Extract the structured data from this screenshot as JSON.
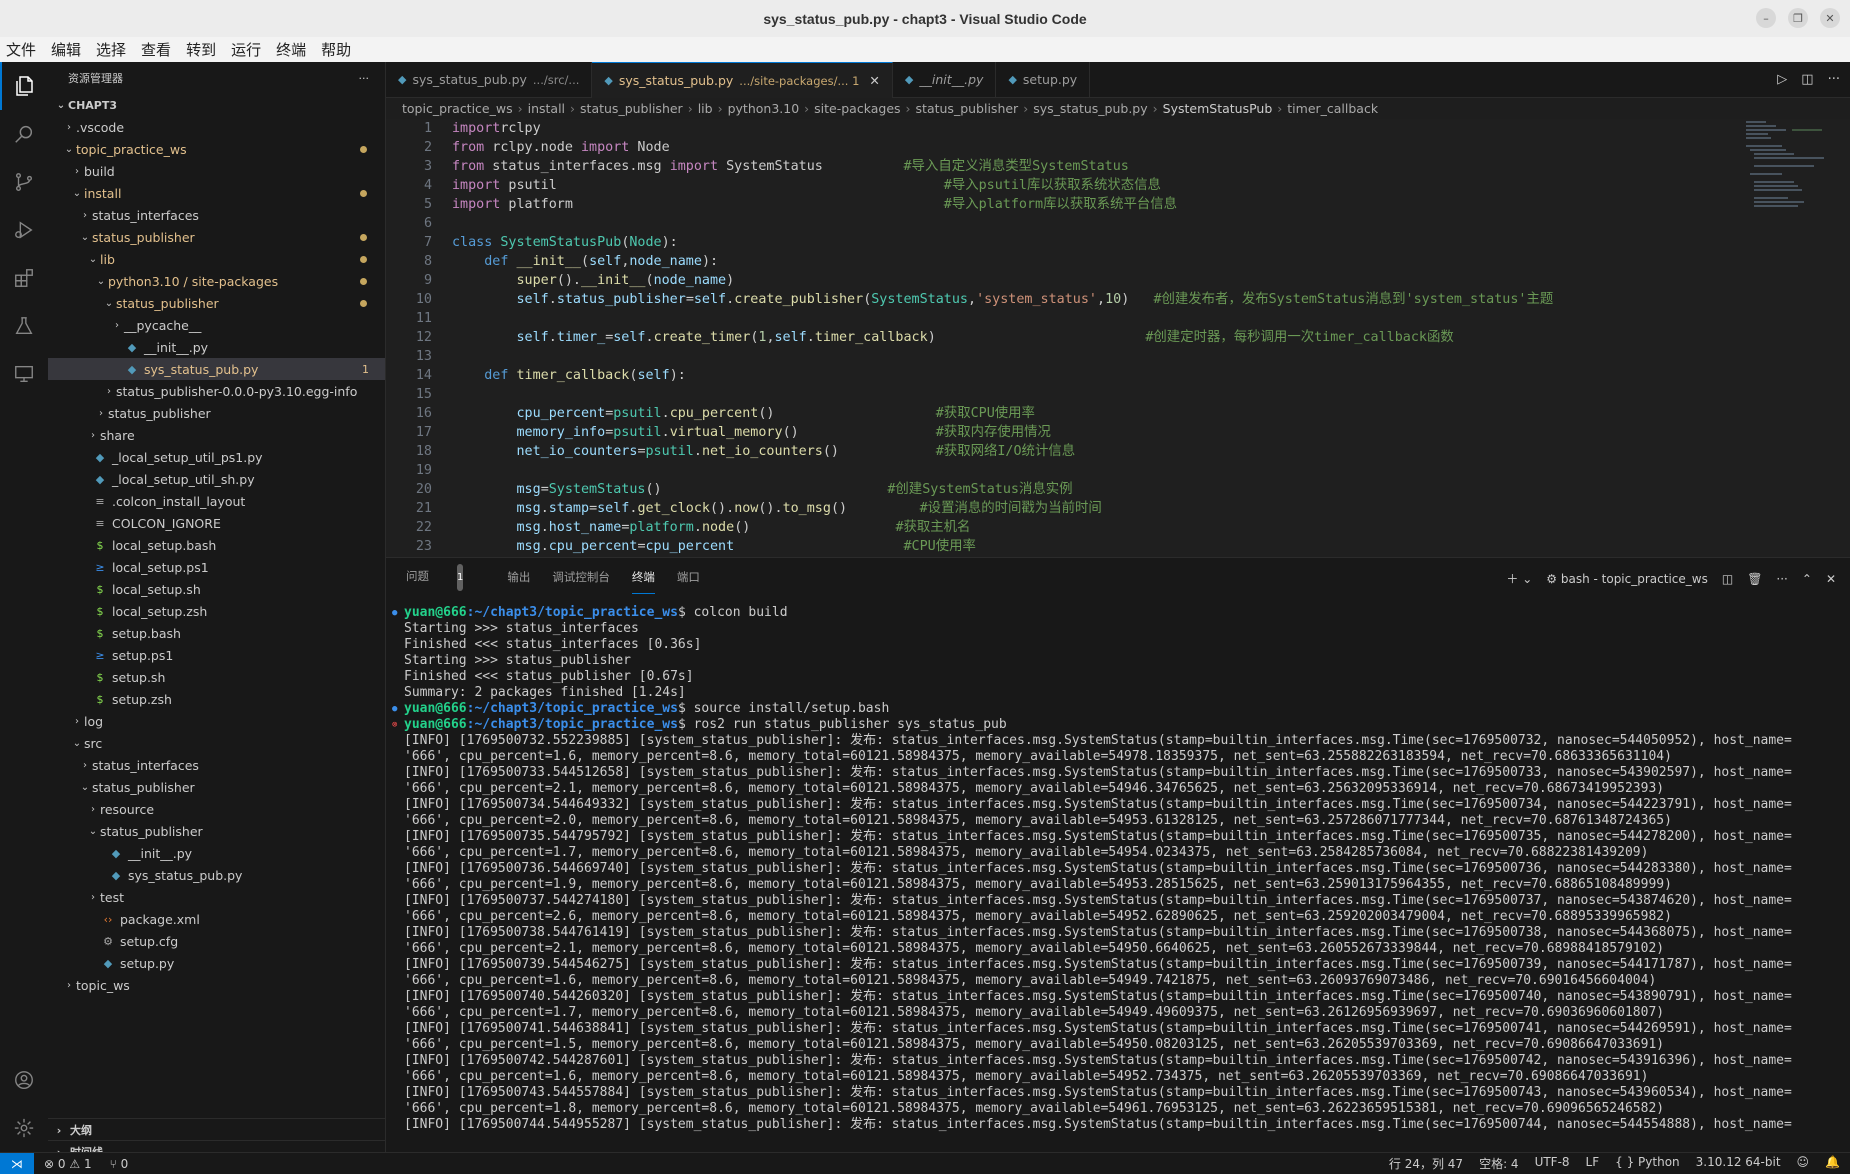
{
  "window": {
    "title": "sys_status_pub.py - chapt3 - Visual Studio Code"
  },
  "menu": [
    "文件",
    "编辑",
    "选择",
    "查看",
    "转到",
    "运行",
    "终端",
    "帮助"
  ],
  "sidebar": {
    "header": "资源管理器",
    "root": "CHAPT3",
    "tree": [
      {
        "label": ".vscode",
        "depth": 1,
        "chev": "›",
        "icon": ""
      },
      {
        "label": "topic_practice_ws",
        "depth": 1,
        "chev": "⌄",
        "icon": "",
        "mod": true,
        "dot": true
      },
      {
        "label": "build",
        "depth": 2,
        "chev": "›",
        "icon": ""
      },
      {
        "label": "install",
        "depth": 2,
        "chev": "⌄",
        "icon": "",
        "mod": true,
        "dot": true
      },
      {
        "label": "status_interfaces",
        "depth": 3,
        "chev": "›",
        "icon": ""
      },
      {
        "label": "status_publisher",
        "depth": 3,
        "chev": "⌄",
        "icon": "",
        "mod": true,
        "dot": true
      },
      {
        "label": "lib",
        "depth": 4,
        "chev": "⌄",
        "icon": "",
        "mod": true,
        "dot": true
      },
      {
        "label": "python3.10 / site-packages",
        "depth": 5,
        "chev": "⌄",
        "icon": "",
        "mod": true,
        "dot": true
      },
      {
        "label": "status_publisher",
        "depth": 6,
        "chev": "⌄",
        "icon": "",
        "mod": true,
        "dot": true
      },
      {
        "label": "__pycache__",
        "depth": 7,
        "chev": "›",
        "icon": ""
      },
      {
        "label": "__init__.py",
        "depth": 7,
        "chev": "",
        "icon": "py"
      },
      {
        "label": "sys_status_pub.py",
        "depth": 7,
        "chev": "",
        "icon": "py",
        "mod": true,
        "sel": true,
        "num": "1"
      },
      {
        "label": "status_publisher-0.0.0-py3.10.egg-info",
        "depth": 6,
        "chev": "›",
        "icon": ""
      },
      {
        "label": "status_publisher",
        "depth": 5,
        "chev": "›",
        "icon": ""
      },
      {
        "label": "share",
        "depth": 4,
        "chev": "›",
        "icon": ""
      },
      {
        "label": "_local_setup_util_ps1.py",
        "depth": 3,
        "chev": "",
        "icon": "py"
      },
      {
        "label": "_local_setup_util_sh.py",
        "depth": 3,
        "chev": "",
        "icon": "py"
      },
      {
        "label": ".colcon_install_layout",
        "depth": 3,
        "chev": "",
        "icon": "txt"
      },
      {
        "label": "COLCON_IGNORE",
        "depth": 3,
        "chev": "",
        "icon": "txt"
      },
      {
        "label": "local_setup.bash",
        "depth": 3,
        "chev": "",
        "icon": "sh"
      },
      {
        "label": "local_setup.ps1",
        "depth": 3,
        "chev": "",
        "icon": "ps"
      },
      {
        "label": "local_setup.sh",
        "depth": 3,
        "chev": "",
        "icon": "sh"
      },
      {
        "label": "local_setup.zsh",
        "depth": 3,
        "chev": "",
        "icon": "sh"
      },
      {
        "label": "setup.bash",
        "depth": 3,
        "chev": "",
        "icon": "sh"
      },
      {
        "label": "setup.ps1",
        "depth": 3,
        "chev": "",
        "icon": "ps"
      },
      {
        "label": "setup.sh",
        "depth": 3,
        "chev": "",
        "icon": "sh"
      },
      {
        "label": "setup.zsh",
        "depth": 3,
        "chev": "",
        "icon": "sh"
      },
      {
        "label": "log",
        "depth": 2,
        "chev": "›",
        "icon": ""
      },
      {
        "label": "src",
        "depth": 2,
        "chev": "⌄",
        "icon": ""
      },
      {
        "label": "status_interfaces",
        "depth": 3,
        "chev": "›",
        "icon": ""
      },
      {
        "label": "status_publisher",
        "depth": 3,
        "chev": "⌄",
        "icon": ""
      },
      {
        "label": "resource",
        "depth": 4,
        "chev": "›",
        "icon": ""
      },
      {
        "label": "status_publisher",
        "depth": 4,
        "chev": "⌄",
        "icon": ""
      },
      {
        "label": "__init__.py",
        "depth": 5,
        "chev": "",
        "icon": "py"
      },
      {
        "label": "sys_status_pub.py",
        "depth": 5,
        "chev": "",
        "icon": "py"
      },
      {
        "label": "test",
        "depth": 4,
        "chev": "›",
        "icon": ""
      },
      {
        "label": "package.xml",
        "depth": 4,
        "chev": "",
        "icon": "xml"
      },
      {
        "label": "setup.cfg",
        "depth": 4,
        "chev": "",
        "icon": "cfg"
      },
      {
        "label": "setup.py",
        "depth": 4,
        "chev": "",
        "icon": "py"
      },
      {
        "label": "topic_ws",
        "depth": 1,
        "chev": "›",
        "icon": ""
      }
    ],
    "outline": "大纲",
    "timeline": "时间线"
  },
  "tabs": [
    {
      "name": "sys_status_pub.py",
      "path": ".../src/...",
      "active": false
    },
    {
      "name": "sys_status_pub.py",
      "path": ".../site-packages/... 1",
      "active": true
    },
    {
      "name": "__init__.py",
      "path": "",
      "active": false
    },
    {
      "name": "setup.py",
      "path": "",
      "active": false
    }
  ],
  "breadcrumb": [
    "topic_practice_ws",
    "install",
    "status_publisher",
    "lib",
    "python3.10",
    "site-packages",
    "status_publisher",
    "sys_status_pub.py",
    "SystemStatusPub",
    "timer_callback"
  ],
  "code": [
    [
      [
        "kwc",
        "import"
      ],
      [
        "",
        "rclpy"
      ]
    ],
    [
      [
        "kwc",
        "from"
      ],
      [
        "",
        " rclpy.node "
      ],
      [
        "kwc",
        "import"
      ],
      [
        "",
        " Node"
      ]
    ],
    [
      [
        "kwc",
        "from"
      ],
      [
        "",
        " status_interfaces.msg "
      ],
      [
        "kwc",
        "import"
      ],
      [
        "",
        " SystemStatus          "
      ],
      [
        "cm",
        "#导入自定义消息类型SystemStatus"
      ]
    ],
    [
      [
        "kwc",
        "import"
      ],
      [
        "",
        " psutil                                                "
      ],
      [
        "cm",
        "#导入psutil库以获取系统状态信息"
      ]
    ],
    [
      [
        "kwc",
        "import"
      ],
      [
        "",
        " platform                                              "
      ],
      [
        "cm",
        "#导入platform库以获取系统平台信息"
      ]
    ],
    [],
    [
      [
        "kw",
        "class"
      ],
      [
        "",
        " "
      ],
      [
        "cls",
        "SystemStatusPub"
      ],
      [
        "",
        "("
      ],
      [
        "cls",
        "Node"
      ],
      [
        "",
        "):"
      ]
    ],
    [
      [
        "",
        "    "
      ],
      [
        "kw",
        "def"
      ],
      [
        "",
        " "
      ],
      [
        "fn",
        "__init__"
      ],
      [
        "",
        "("
      ],
      [
        "var",
        "self"
      ],
      [
        "",
        ","
      ],
      [
        "var",
        "node_name"
      ],
      [
        "",
        "):"
      ]
    ],
    [
      [
        "",
        "        "
      ],
      [
        "fn",
        "super"
      ],
      [
        "",
        "()."
      ],
      [
        "fn",
        "__init__"
      ],
      [
        "",
        "("
      ],
      [
        "var",
        "node_name"
      ],
      [
        "",
        ")"
      ]
    ],
    [
      [
        "",
        "        "
      ],
      [
        "var",
        "self"
      ],
      [
        "",
        "."
      ],
      [
        "var",
        "status_publisher"
      ],
      [
        "",
        "="
      ],
      [
        "var",
        "self"
      ],
      [
        "",
        "."
      ],
      [
        "fn",
        "create_publisher"
      ],
      [
        "",
        "("
      ],
      [
        "cls",
        "SystemStatus"
      ],
      [
        "",
        ","
      ],
      [
        "str",
        "'system_status'"
      ],
      [
        "",
        ","
      ],
      [
        "num-lit",
        "10"
      ],
      [
        "",
        ")   "
      ],
      [
        "cm",
        "#创建发布者，发布SystemStatus消息到'system_status'主题"
      ]
    ],
    [],
    [
      [
        "",
        "        "
      ],
      [
        "var",
        "self"
      ],
      [
        "",
        "."
      ],
      [
        "var",
        "timer_"
      ],
      [
        "",
        "="
      ],
      [
        "var",
        "self"
      ],
      [
        "",
        "."
      ],
      [
        "fn",
        "create_timer"
      ],
      [
        "",
        "("
      ],
      [
        "num-lit",
        "1"
      ],
      [
        "",
        ","
      ],
      [
        "var",
        "self"
      ],
      [
        "",
        "."
      ],
      [
        "fn",
        "timer_callback"
      ],
      [
        "",
        ")                          "
      ],
      [
        "cm",
        "#创建定时器，每秒调用一次timer_callback函数"
      ]
    ],
    [],
    [
      [
        "",
        "    "
      ],
      [
        "kw",
        "def"
      ],
      [
        "",
        " "
      ],
      [
        "fn",
        "timer_callback"
      ],
      [
        "",
        "("
      ],
      [
        "var",
        "self"
      ],
      [
        "",
        "):"
      ]
    ],
    [],
    [
      [
        "",
        "        "
      ],
      [
        "var",
        "cpu_percent"
      ],
      [
        "",
        "="
      ],
      [
        "cls",
        "psutil"
      ],
      [
        "",
        "."
      ],
      [
        "fn",
        "cpu_percent"
      ],
      [
        "",
        "()                    "
      ],
      [
        "cm",
        "#获取CPU使用率"
      ]
    ],
    [
      [
        "",
        "        "
      ],
      [
        "var",
        "memory_info"
      ],
      [
        "",
        "="
      ],
      [
        "cls",
        "psutil"
      ],
      [
        "",
        "."
      ],
      [
        "fn",
        "virtual_memory"
      ],
      [
        "",
        "()                 "
      ],
      [
        "cm",
        "#获取内存使用情况"
      ]
    ],
    [
      [
        "",
        "        "
      ],
      [
        "var",
        "net_io_counters"
      ],
      [
        "",
        "="
      ],
      [
        "cls",
        "psutil"
      ],
      [
        "",
        "."
      ],
      [
        "fn",
        "net_io_counters"
      ],
      [
        "",
        "()            "
      ],
      [
        "cm",
        "#获取网络I/O统计信息"
      ]
    ],
    [],
    [
      [
        "",
        "        "
      ],
      [
        "var",
        "msg"
      ],
      [
        "",
        "="
      ],
      [
        "cls",
        "SystemStatus"
      ],
      [
        "",
        "()                            "
      ],
      [
        "cm",
        "#创建SystemStatus消息实例"
      ]
    ],
    [
      [
        "",
        "        "
      ],
      [
        "var",
        "msg"
      ],
      [
        "",
        "."
      ],
      [
        "var",
        "stamp"
      ],
      [
        "",
        "="
      ],
      [
        "var",
        "self"
      ],
      [
        "",
        "."
      ],
      [
        "fn",
        "get_clock"
      ],
      [
        "",
        "()."
      ],
      [
        "fn",
        "now"
      ],
      [
        "",
        "()."
      ],
      [
        "fn",
        "to_msg"
      ],
      [
        "",
        "()         "
      ],
      [
        "cm",
        "#设置消息的时间戳为当前时间"
      ]
    ],
    [
      [
        "",
        "        "
      ],
      [
        "var",
        "msg"
      ],
      [
        "",
        "."
      ],
      [
        "var",
        "host_name"
      ],
      [
        "",
        "="
      ],
      [
        "cls",
        "platform"
      ],
      [
        "",
        "."
      ],
      [
        "fn",
        "node"
      ],
      [
        "",
        "()                  "
      ],
      [
        "cm",
        "#获取主机名"
      ]
    ],
    [
      [
        "",
        "        "
      ],
      [
        "var",
        "msg"
      ],
      [
        "",
        "."
      ],
      [
        "var",
        "cpu_percent"
      ],
      [
        "",
        "="
      ],
      [
        "var",
        "cpu_percent"
      ],
      [
        "",
        "                     "
      ],
      [
        "cm",
        "#CPU使用率"
      ]
    ]
  ],
  "panel": {
    "tabs": [
      "问题",
      "输出",
      "调试控制台",
      "终端",
      "端口"
    ],
    "problems_count": "1",
    "shell": "bash - topic_practice_ws"
  },
  "terminal": {
    "user": "yuan@666",
    "path": ":~/chapt3/topic_practice_ws",
    "lines": [
      {
        "t": "prompt",
        "m": "ok",
        "cmd": "$ colcon build"
      },
      {
        "t": "out",
        "text": "Starting >>> status_interfaces"
      },
      {
        "t": "out",
        "text": "Finished <<< status_interfaces [0.36s]"
      },
      {
        "t": "out",
        "text": "Starting >>> status_publisher"
      },
      {
        "t": "out",
        "text": "Finished <<< status_publisher [0.67s]"
      },
      {
        "t": "out",
        "text": ""
      },
      {
        "t": "out",
        "text": "Summary: 2 packages finished [1.24s]"
      },
      {
        "t": "prompt",
        "m": "ok",
        "cmd": "$ source install/setup.bash"
      },
      {
        "t": "prompt",
        "m": "err",
        "cmd": "$ ros2 run status_publisher sys_status_pub"
      },
      {
        "t": "out",
        "text": "[INFO] [1769500732.552239885] [system_status_publisher]: 发布: status_interfaces.msg.SystemStatus(stamp=builtin_interfaces.msg.Time(sec=1769500732, nanosec=544050952), host_name="
      },
      {
        "t": "out",
        "text": "'666', cpu_percent=1.6, memory_percent=8.6, memory_total=60121.58984375, memory_available=54978.18359375, net_sent=63.255882263183594, net_recv=70.68633365631104)"
      },
      {
        "t": "out",
        "text": "[INFO] [1769500733.544512658] [system_status_publisher]: 发布: status_interfaces.msg.SystemStatus(stamp=builtin_interfaces.msg.Time(sec=1769500733, nanosec=543902597), host_name="
      },
      {
        "t": "out",
        "text": "'666', cpu_percent=2.1, memory_percent=8.6, memory_total=60121.58984375, memory_available=54946.34765625, net_sent=63.25632095336914, net_recv=70.68673419952393)"
      },
      {
        "t": "out",
        "text": "[INFO] [1769500734.544649332] [system_status_publisher]: 发布: status_interfaces.msg.SystemStatus(stamp=builtin_interfaces.msg.Time(sec=1769500734, nanosec=544223791), host_name="
      },
      {
        "t": "out",
        "text": "'666', cpu_percent=2.0, memory_percent=8.6, memory_total=60121.58984375, memory_available=54953.61328125, net_sent=63.257286071777344, net_recv=70.68761348724365)"
      },
      {
        "t": "out",
        "text": "[INFO] [1769500735.544795792] [system_status_publisher]: 发布: status_interfaces.msg.SystemStatus(stamp=builtin_interfaces.msg.Time(sec=1769500735, nanosec=544278200), host_name="
      },
      {
        "t": "out",
        "text": "'666', cpu_percent=1.7, memory_percent=8.6, memory_total=60121.58984375, memory_available=54954.0234375, net_sent=63.2584285736084, net_recv=70.68822381439209)"
      },
      {
        "t": "out",
        "text": "[INFO] [1769500736.544669740] [system_status_publisher]: 发布: status_interfaces.msg.SystemStatus(stamp=builtin_interfaces.msg.Time(sec=1769500736, nanosec=544283380), host_name="
      },
      {
        "t": "out",
        "text": "'666', cpu_percent=1.9, memory_percent=8.6, memory_total=60121.58984375, memory_available=54953.28515625, net_sent=63.259013175964355, net_recv=70.68865108489999)"
      },
      {
        "t": "out",
        "text": "[INFO] [1769500737.544274180] [system_status_publisher]: 发布: status_interfaces.msg.SystemStatus(stamp=builtin_interfaces.msg.Time(sec=1769500737, nanosec=543874620), host_name="
      },
      {
        "t": "out",
        "text": "'666', cpu_percent=2.6, memory_percent=8.6, memory_total=60121.58984375, memory_available=54952.62890625, net_sent=63.259202003479004, net_recv=70.68895339965982)"
      },
      {
        "t": "out",
        "text": "[INFO] [1769500738.544761419] [system_status_publisher]: 发布: status_interfaces.msg.SystemStatus(stamp=builtin_interfaces.msg.Time(sec=1769500738, nanosec=544368075), host_name="
      },
      {
        "t": "out",
        "text": "'666', cpu_percent=2.1, memory_percent=8.6, memory_total=60121.58984375, memory_available=54950.6640625, net_sent=63.260552673339844, net_recv=70.68988418579102)"
      },
      {
        "t": "out",
        "text": "[INFO] [1769500739.544546275] [system_status_publisher]: 发布: status_interfaces.msg.SystemStatus(stamp=builtin_interfaces.msg.Time(sec=1769500739, nanosec=544171787), host_name="
      },
      {
        "t": "out",
        "text": "'666', cpu_percent=1.6, memory_percent=8.6, memory_total=60121.58984375, memory_available=54949.7421875, net_sent=63.26093769073486, net_recv=70.69016456604004)"
      },
      {
        "t": "out",
        "text": "[INFO] [1769500740.544260320] [system_status_publisher]: 发布: status_interfaces.msg.SystemStatus(stamp=builtin_interfaces.msg.Time(sec=1769500740, nanosec=543890791), host_name="
      },
      {
        "t": "out",
        "text": "'666', cpu_percent=1.7, memory_percent=8.6, memory_total=60121.58984375, memory_available=54949.49609375, net_sent=63.26126956939697, net_recv=70.69036960601807)"
      },
      {
        "t": "out",
        "text": "[INFO] [1769500741.544638841] [system_status_publisher]: 发布: status_interfaces.msg.SystemStatus(stamp=builtin_interfaces.msg.Time(sec=1769500741, nanosec=544269591), host_name="
      },
      {
        "t": "out",
        "text": "'666', cpu_percent=1.5, memory_percent=8.6, memory_total=60121.58984375, memory_available=54950.08203125, net_sent=63.26205539703369, net_recv=70.69086647033691)"
      },
      {
        "t": "out",
        "text": "[INFO] [1769500742.544287601] [system_status_publisher]: 发布: status_interfaces.msg.SystemStatus(stamp=builtin_interfaces.msg.Time(sec=1769500742, nanosec=543916396), host_name="
      },
      {
        "t": "out",
        "text": "'666', cpu_percent=1.6, memory_percent=8.6, memory_total=60121.58984375, memory_available=54952.734375, net_sent=63.26205539703369, net_recv=70.69086647033691)"
      },
      {
        "t": "out",
        "text": "[INFO] [1769500743.544557884] [system_status_publisher]: 发布: status_interfaces.msg.SystemStatus(stamp=builtin_interfaces.msg.Time(sec=1769500743, nanosec=543960534), host_name="
      },
      {
        "t": "out",
        "text": "'666', cpu_percent=1.8, memory_percent=8.6, memory_total=60121.58984375, memory_available=54961.76953125, net_sent=63.26223659515381, net_recv=70.69096565246582)"
      },
      {
        "t": "out",
        "text": "[INFO] [1769500744.544955287] [system_status_publisher]: 发布: status_interfaces.msg.SystemStatus(stamp=builtin_interfaces.msg.Time(sec=1769500744, nanosec=544554888), host_name="
      }
    ]
  },
  "status": {
    "errors": "0",
    "warnings": "1",
    "ports": "0",
    "position": "行 24，列 47",
    "spaces": "空格: 4",
    "encoding": "UTF-8",
    "eol": "LF",
    "language": "Python",
    "interpreter": "3.10.12 64-bit"
  },
  "colors": {
    "accent": "#0078d4",
    "modified": "#e2c08d",
    "prompt": "#23d18b",
    "path": "#3b8eea"
  }
}
